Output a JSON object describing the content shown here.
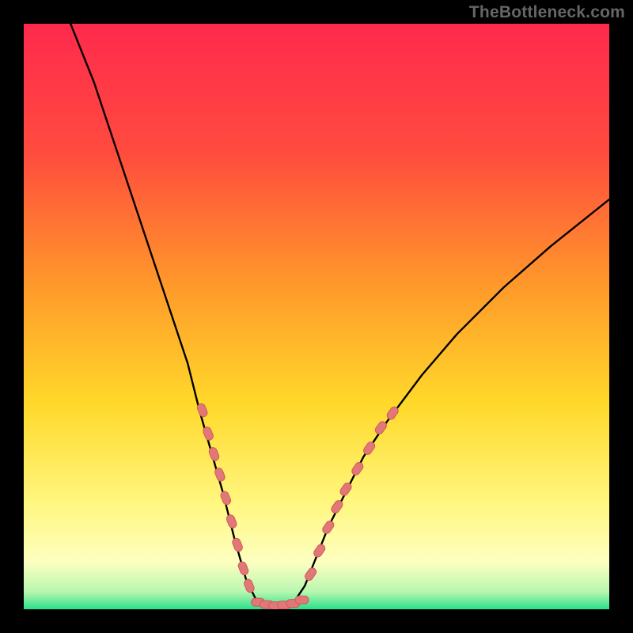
{
  "watermark": "TheBottleneck.com",
  "chart_data": {
    "type": "line",
    "title": "",
    "xlabel": "",
    "ylabel": "",
    "xlim": [
      0,
      100
    ],
    "ylim": [
      0,
      100
    ],
    "legend": false,
    "grid": false,
    "background_gradient": {
      "top_color": "#ff2a4d",
      "mid_colors": [
        "#ff6a33",
        "#ffc62a",
        "#fff780",
        "#fcffb4"
      ],
      "bottom_color": "#29e08a"
    },
    "curve": {
      "description": "Asymmetric V-shaped bottleneck curve with minimum near x≈40",
      "points_xy": [
        [
          8,
          100
        ],
        [
          12,
          90
        ],
        [
          16,
          78
        ],
        [
          20,
          66
        ],
        [
          24,
          54
        ],
        [
          28,
          42
        ],
        [
          30,
          34
        ],
        [
          32,
          27
        ],
        [
          34,
          20
        ],
        [
          36,
          12
        ],
        [
          38,
          5
        ],
        [
          40,
          1
        ],
        [
          42,
          0.5
        ],
        [
          44,
          0.5
        ],
        [
          46,
          1
        ],
        [
          48,
          4
        ],
        [
          50,
          9
        ],
        [
          52,
          14
        ],
        [
          55,
          20
        ],
        [
          58,
          26
        ],
        [
          62,
          32
        ],
        [
          68,
          40
        ],
        [
          74,
          47
        ],
        [
          82,
          55
        ],
        [
          90,
          62
        ],
        [
          100,
          70
        ]
      ]
    },
    "marker_clusters": [
      {
        "side": "left",
        "points_xy": [
          [
            30.5,
            34
          ],
          [
            31.5,
            30
          ],
          [
            32.5,
            26.5
          ],
          [
            33.5,
            23
          ],
          [
            34.5,
            19
          ],
          [
            35.5,
            15
          ],
          [
            36.5,
            11
          ],
          [
            37.5,
            7
          ],
          [
            38.5,
            4
          ]
        ]
      },
      {
        "side": "bottom",
        "points_xy": [
          [
            40,
            1.2
          ],
          [
            41.5,
            0.8
          ],
          [
            43,
            0.6
          ],
          [
            44.5,
            0.7
          ],
          [
            46,
            1.0
          ],
          [
            47.5,
            1.6
          ]
        ]
      },
      {
        "side": "right",
        "points_xy": [
          [
            49,
            6
          ],
          [
            50.5,
            10
          ],
          [
            52,
            14
          ],
          [
            53.5,
            17.5
          ],
          [
            55,
            20.5
          ],
          [
            57,
            24
          ],
          [
            59,
            27.5
          ],
          [
            61,
            31
          ],
          [
            63,
            33.5
          ]
        ]
      }
    ],
    "colors": {
      "curve": "#000000",
      "marker_fill": "#e17877",
      "marker_stroke": "#d05a59"
    }
  }
}
